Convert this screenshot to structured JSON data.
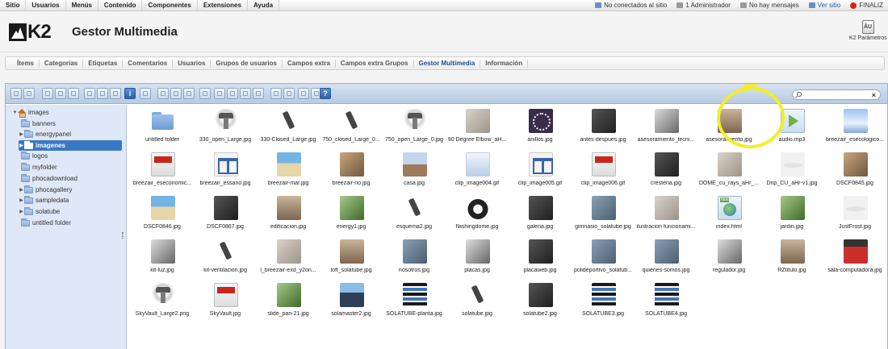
{
  "topbar": {
    "menu": [
      "Sitio",
      "Usuarios",
      "Menús",
      "Contenido",
      "Componentes",
      "Extensiones",
      "Ayuda"
    ],
    "status": [
      {
        "label": "No conectados al sitio",
        "icon": "users-offline-icon"
      },
      {
        "label": "1 Administrador",
        "icon": "admin-user-icon"
      },
      {
        "label": "No hay mensajes",
        "icon": "messages-icon"
      },
      {
        "label": "Ver sitio",
        "icon": "view-site-icon"
      },
      {
        "label": "FINALIZ",
        "icon": "logout-icon"
      }
    ]
  },
  "header": {
    "logo_text": "K2",
    "title": "Gestor Multimedia",
    "params_icon_text": "ÂU",
    "params_label": "K2 Parámetros"
  },
  "submenu": [
    "Ítems",
    "Categorías",
    "Etiquetas",
    "Comentarios",
    "Usuarios",
    "Grupos de usuarios",
    "Campos extra",
    "Campos extra Grupos",
    "Gestor Multimedia",
    "Información"
  ],
  "submenu_active": "Gestor Multimedia",
  "search": {
    "placeholder": "",
    "clear": "×"
  },
  "tree": {
    "root": "images",
    "nodes": [
      {
        "label": "banners",
        "expandable": false
      },
      {
        "label": "energypanel",
        "expandable": true
      },
      {
        "label": "imagenes",
        "expandable": true,
        "selected": true
      },
      {
        "label": "logos",
        "expandable": false
      },
      {
        "label": "myfolder",
        "expandable": false
      },
      {
        "label": "phocadownload",
        "expandable": false
      },
      {
        "label": "phocagallery",
        "expandable": true
      },
      {
        "label": "sampledata",
        "expandable": true
      },
      {
        "label": "solatube",
        "expandable": true
      },
      {
        "label": "untitled folder",
        "expandable": false
      }
    ]
  },
  "files": [
    [
      "untitled folder",
      "330_open_Large.jpg",
      "330-Closed_Large.jpg",
      "750_closed_Large_0...",
      "750_open_Large_0.jpg",
      "90 Degree Elbow_aH...",
      "anillos.jpg",
      "antes-despues.jpg",
      "asesoramiento_tecni...",
      "asesoramiento.jpg",
      "audio.mp3",
      "breezair_esecologico..."
    ],
    [
      "breezair_eseconomic...",
      "breezair_essano.jpg",
      "breezair-mar.jpg",
      "breezair-rio.jpg",
      "casa.jpg",
      "clip_image004.gif",
      "clip_image005.gif",
      "clip_image006.gif",
      "cresteria.jpg",
      "DOME_cu_rays_aHr_...",
      "Drip_CU_aHr-v1.jpg",
      "DSCF0845.jpg"
    ],
    [
      "DSCF0846.jpg",
      "DSCF0867.jpg",
      "edificacion.jpg",
      "energy1.jpg",
      "esquema2.jpg",
      "flashingdome.jpg",
      "galeria.jpg",
      "gimnasio_solatube.jpg",
      "ilustracion funcionami...",
      "index.html",
      "jardin.jpg",
      "JustFrost.jpg"
    ],
    [
      "kit-luz.jpg",
      "kit-ventilacion.jpg",
      "l_breezair-exd_y2on...",
      "loft_solatube.jpg",
      "nosotros.jpg",
      "placas.jpg",
      "placaweb.jpg",
      "polideportivo_solatub...",
      "quienes-somos.jpg",
      "regulador.jpg",
      "RZtitulo.jpg",
      "sala-computadora.jpg"
    ],
    [
      "SkyVault_Large2.png",
      "SkyVault.jpg",
      "slide_pan-21.jpg",
      "solamaster2.jpg",
      "SOLATUBE-planta.jpg",
      "solatube.jpg",
      "solatube2.jpg",
      "SOLATUBE3.jpg",
      "SOLATUBE4.jpg"
    ]
  ]
}
